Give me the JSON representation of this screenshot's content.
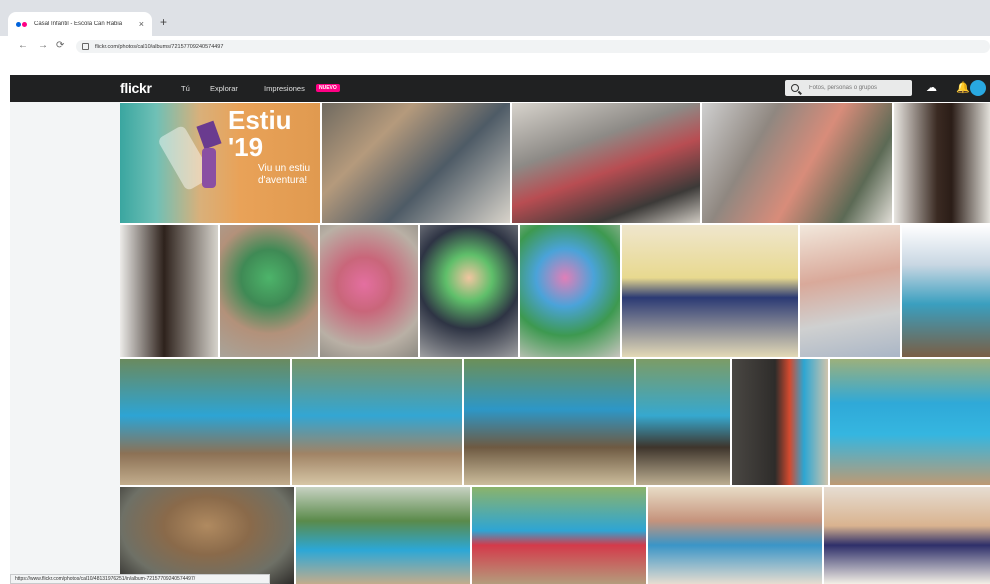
{
  "browser": {
    "tab_title": "Casal Infantil - Escola Can Rabia",
    "tab_close": "×",
    "new_tab": "+",
    "back": "←",
    "forward": "→",
    "reload": "⟳",
    "url": "flickr.com/photos/cal10/albums/72157709240574497"
  },
  "header": {
    "logo": "flickr",
    "nav": [
      "Tú",
      "Explorar",
      "Impresiones"
    ],
    "badge": "NUEVO",
    "search_placeholder": "Fotos, personas o grupos",
    "icons": [
      "upload-icon",
      "bell-icon",
      "avatar"
    ]
  },
  "promo": {
    "title": "Estiu",
    "year": "'19",
    "subtitle": "Viu un estiu d'aventura!"
  },
  "status_url": "https://www.flickr.com/photos/cal10/48131976251/in/album-72157709240574497/",
  "colors": {
    "header_bg": "#202122",
    "brand_pink": "#ff0084",
    "brand_blue": "#0063dc",
    "promo_orange": "#e9a258"
  },
  "tiles": [
    {
      "name": "photo-children-stairs",
      "bg": "linear-gradient(135deg,#6f6a60 0%,#b59a7c 30%,#4e5b66 60%,#d8d3ca 100%)"
    },
    {
      "name": "photo-children-hallway",
      "bg": "linear-gradient(160deg,#d7d3cc 0%,#8d8a86 35%,#b84d52 55%,#3c3a38 80%,#cfcac2 100%)"
    },
    {
      "name": "photo-group-staircase",
      "bg": "linear-gradient(120deg,#cfcfcf 0%,#8f8780 30%,#d88c7a 55%,#5c6a55 80%,#e0ddd6 100%)"
    },
    {
      "name": "photo-costume-wig",
      "bg": "linear-gradient(90deg,#e8e6e1 0%,#3a2a22 45%,#2b1d17 60%,#e2e0da 100%)"
    },
    {
      "name": "photo-hairy-costume",
      "bg": "linear-gradient(90deg,#ecebe8 0%,#2e221c 45%,#d6d3cc 100%)"
    },
    {
      "name": "photo-green-mask",
      "bg": "radial-gradient(circle at 50% 40%,#4db46a 0%,#3f8a55 30%,#b3917a 60%,#a8a49a 100%)"
    },
    {
      "name": "photo-pink-mask",
      "bg": "radial-gradient(circle at 45% 45%,#e46fa0 0%,#c9667a 30%,#b9b0a5 70%,#8d8a82 100%)"
    },
    {
      "name": "photo-boy-green-cap",
      "bg": "radial-gradient(circle at 50% 40%,#f1c5a0 0%,#5fbf6a 25%,#2e3444 55%,#9fa0a2 100%)"
    },
    {
      "name": "photo-colorful-mask",
      "bg": "radial-gradient(circle at 45% 40%,#e07fb8 0%,#4aa3d9 30%,#3d9950 60%,#c7c4be 100%)"
    },
    {
      "name": "photo-yellow-craft",
      "bg": "linear-gradient(180deg,#efe6cd 0%,#e8d98f 40%,#2b3a74 55%,#e3d9b6 100%)"
    },
    {
      "name": "photo-painted-box",
      "bg": "linear-gradient(170deg,#f2e8dc 0%,#d9a99a 40%,#cfd0d0 70%,#aab6c6 100%)"
    },
    {
      "name": "photo-playground",
      "bg": "linear-gradient(180deg,#ffffff 0%,#c9d7e3 30%,#3a9fbf 60%,#7a5e44 100%)"
    },
    {
      "name": "photo-kids-walking",
      "bg": "linear-gradient(180deg,#6a8a5e 0%,#2da4d4 45%,#8c7155 75%,#c2ad8d 100%)"
    },
    {
      "name": "photo-trail-group",
      "bg": "linear-gradient(180deg,#7a9465 0%,#33a6d3 45%,#a08365 75%,#d6c6a5 100%)"
    },
    {
      "name": "photo-forest-walk",
      "bg": "linear-gradient(180deg,#6c8f58 0%,#2d97c7 40%,#6e5a42 70%,#ccbd9c 100%)"
    },
    {
      "name": "photo-boy-fence",
      "bg": "linear-gradient(180deg,#7c9c66 0%,#36a8cf 45%,#3e352c 70%,#bcae91 100%)"
    },
    {
      "name": "photo-gate-walk",
      "bg": "linear-gradient(90deg,#4a4743 0%,#2e2c2a 45%,#d44a2f 60%,#2da6d2 75%,#cfc4ad 100%)"
    },
    {
      "name": "photo-group-sitting",
      "bg": "linear-gradient(180deg,#9cb07c 0%,#2fa9d8 35%,#35b6e0 60%,#bd9a74 100%)"
    },
    {
      "name": "photo-lizard",
      "bg": "radial-gradient(ellipse at 50% 40%,#b08a60 0%,#8a6a4a 35%,#6e7066 70%,#2d2b29 100%)"
    },
    {
      "name": "photo-group-trees",
      "bg": "linear-gradient(180deg,#c7d2c2 0%,#5a8a4a 35%,#2ca7d6 65%,#c2ac8c 100%)"
    },
    {
      "name": "photo-kids-line",
      "bg": "linear-gradient(180deg,#8bb36b 0%,#2ea5d4 45%,#d43a4a 60%,#b49c7c 100%)"
    },
    {
      "name": "photo-lunch-1",
      "bg": "linear-gradient(180deg,#e8dcc6 0%,#c5937c 35%,#3a95c7 60%,#e6ddd0 100%)"
    },
    {
      "name": "photo-lunch-2",
      "bg": "linear-gradient(180deg,#e6ddd2 0%,#d9b38f 40%,#2e2f6a 60%,#f3efe6 100%)"
    }
  ]
}
